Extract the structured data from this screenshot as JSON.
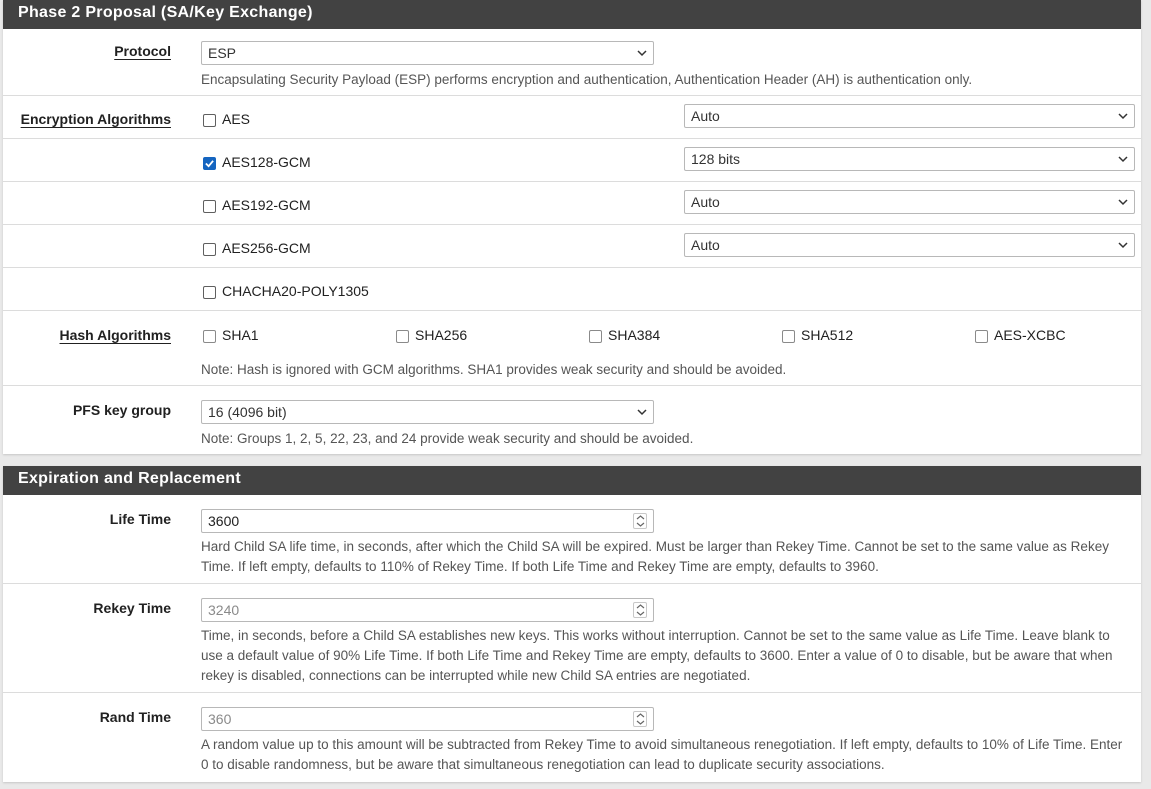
{
  "phase2": {
    "heading": "Phase 2 Proposal (SA/Key Exchange)",
    "protocol": {
      "label": "Protocol",
      "value": "ESP",
      "help": "Encapsulating Security Payload (ESP) performs encryption and authentication, Authentication Header (AH) is authentication only."
    },
    "encryption": {
      "label": "Encryption Algorithms",
      "items": [
        {
          "name": "AES",
          "checked": false,
          "keylen": "Auto"
        },
        {
          "name": "AES128-GCM",
          "checked": true,
          "keylen": "128 bits"
        },
        {
          "name": "AES192-GCM",
          "checked": false,
          "keylen": "Auto"
        },
        {
          "name": "AES256-GCM",
          "checked": false,
          "keylen": "Auto"
        },
        {
          "name": "CHACHA20-POLY1305",
          "checked": false,
          "keylen": ""
        }
      ]
    },
    "hash": {
      "label": "Hash Algorithms",
      "items": [
        {
          "name": "SHA1",
          "checked": false
        },
        {
          "name": "SHA256",
          "checked": false
        },
        {
          "name": "SHA384",
          "checked": false
        },
        {
          "name": "SHA512",
          "checked": false
        },
        {
          "name": "AES-XCBC",
          "checked": false
        }
      ],
      "help": "Note: Hash is ignored with GCM algorithms. SHA1 provides weak security and should be avoided."
    },
    "pfs": {
      "label": "PFS key group",
      "value": "16 (4096 bit)",
      "help": "Note: Groups 1, 2, 5, 22, 23, and 24 provide weak security and should be avoided."
    }
  },
  "expiration": {
    "heading": "Expiration and Replacement",
    "lifetime": {
      "label": "Life Time",
      "value": "3600",
      "help": "Hard Child SA life time, in seconds, after which the Child SA will be expired. Must be larger than Rekey Time. Cannot be set to the same value as Rekey Time. If left empty, defaults to 110% of Rekey Time. If both Life Time and Rekey Time are empty, defaults to 3960."
    },
    "rekeytime": {
      "label": "Rekey Time",
      "placeholder": "3240",
      "help": "Time, in seconds, before a Child SA establishes new keys. This works without interruption. Cannot be set to the same value as Life Time. Leave blank to use a default value of 90% Life Time. If both Life Time and Rekey Time are empty, defaults to 3600. Enter a value of 0 to disable, but be aware that when rekey is disabled, connections can be interrupted while new Child SA entries are negotiated."
    },
    "randtime": {
      "label": "Rand Time",
      "placeholder": "360",
      "help": "A random value up to this amount will be subtracted from Rekey Time to avoid simultaneous renegotiation. If left empty, defaults to 10% of Life Time. Enter 0 to disable randomness, but be aware that simultaneous renegotiation can lead to duplicate security associations."
    }
  }
}
